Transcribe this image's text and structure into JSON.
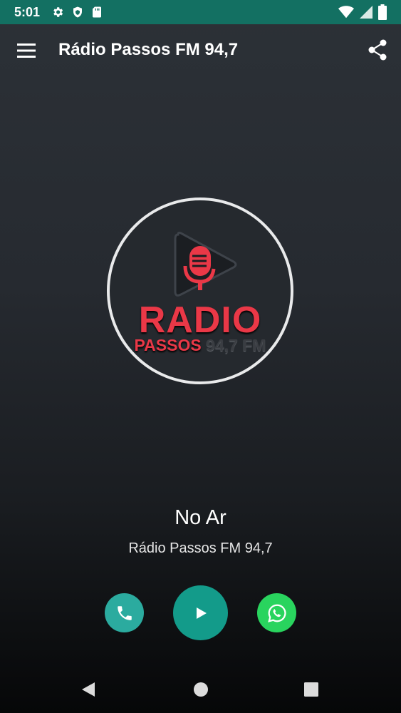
{
  "status_bar": {
    "time": "5:01",
    "icons_left": [
      "gear-icon",
      "shield-icon",
      "sd-card-icon"
    ],
    "icons_right": [
      "wifi-icon",
      "signal-icon",
      "battery-icon"
    ]
  },
  "toolbar": {
    "title": "Rádio Passos FM 94,7",
    "menu_icon": "hamburger-menu-icon",
    "share_icon": "share-icon"
  },
  "logo": {
    "word": "RADIO",
    "sub_a": "PASSOS",
    "sub_b": "94,7 FM"
  },
  "player": {
    "status": "No Ar",
    "station": "Rádio Passos FM 94,7"
  },
  "actions": [
    "phone-icon",
    "play-icon",
    "whatsapp-icon"
  ],
  "colors": {
    "status_bar": "#137062",
    "phone_button": "#2bab9f",
    "play_button": "#139b8a",
    "whatsapp_button": "#29d45e",
    "logo_red": "#ea3847"
  }
}
